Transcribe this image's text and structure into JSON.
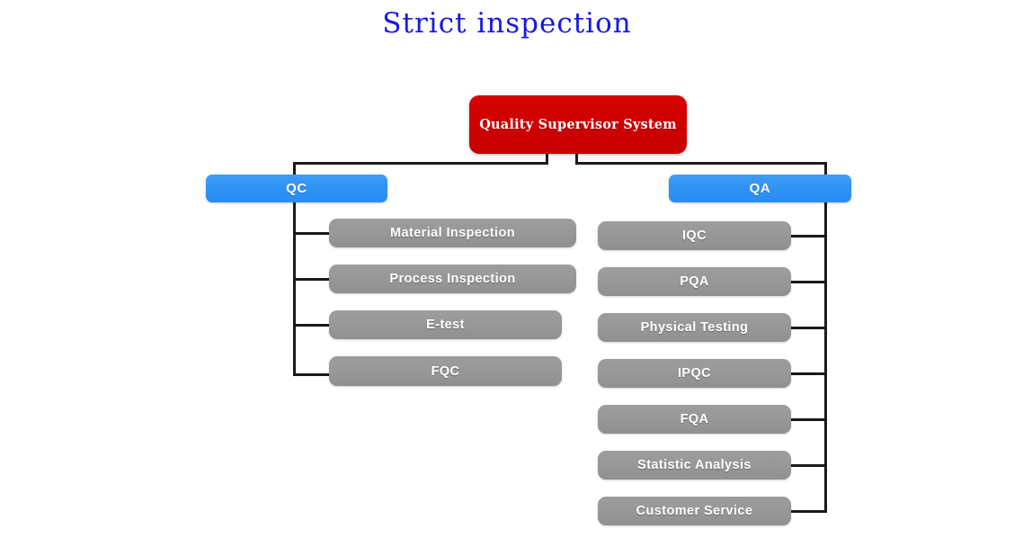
{
  "page": {
    "title": "Strict inspection",
    "title_color": "#1717e8",
    "background": "#ffffff"
  },
  "colors": {
    "root": "#cf0000",
    "department": "#2e92f5",
    "leaf": "#979797",
    "connector": "#1a1a1a",
    "text_on_node": "#ffffff"
  },
  "chart_data": {
    "type": "diagram",
    "diagram_kind": "organizational-tree",
    "title": "Strict inspection",
    "root": {
      "label": "Quality Supervisor System",
      "level": 0,
      "color": "#cf0000"
    },
    "branches": [
      {
        "label": "QC",
        "level": 1,
        "color": "#2e92f5",
        "side": "left",
        "children": [
          "Material Inspection",
          "Process Inspection",
          "E-test",
          "FQC"
        ]
      },
      {
        "label": "QA",
        "level": 1,
        "color": "#2e92f5",
        "side": "right",
        "children": [
          "IQC",
          "PQA",
          "Physical Testing",
          "IPQC",
          "FQA",
          "Statistic Analysis",
          "Customer Service"
        ]
      }
    ]
  },
  "root": {
    "label": "Quality Supervisor System"
  },
  "qc": {
    "label": "QC",
    "children": [
      {
        "label": "Material Inspection"
      },
      {
        "label": "Process Inspection"
      },
      {
        "label": "E-test"
      },
      {
        "label": "FQC"
      }
    ]
  },
  "qa": {
    "label": "QA",
    "children": [
      {
        "label": "IQC"
      },
      {
        "label": "PQA"
      },
      {
        "label": "Physical Testing"
      },
      {
        "label": "IPQC"
      },
      {
        "label": "FQA"
      },
      {
        "label": "Statistic Analysis"
      },
      {
        "label": "Customer Service"
      }
    ]
  }
}
